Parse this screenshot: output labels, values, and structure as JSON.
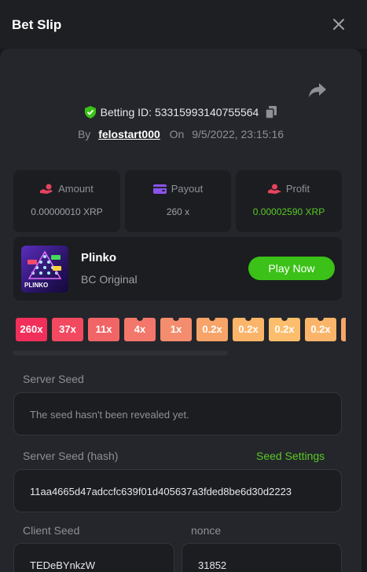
{
  "header": {
    "title": "Bet Slip",
    "close_icon": "close-icon"
  },
  "bet": {
    "betting_id_label": "Betting ID:",
    "betting_id": "53315993140755564",
    "by_label": "By",
    "username": "felostart000",
    "on_label": "On",
    "date": "9/5/2022, 23:15:16"
  },
  "stats": [
    {
      "label": "Amount",
      "value": "0.00000010 XRP",
      "icon": "coin-hand-icon",
      "color": "#e8435d"
    },
    {
      "label": "Payout",
      "value": "260 x",
      "icon": "wallet-icon",
      "color": "#8a53f0"
    },
    {
      "label": "Profit",
      "value": "0.00002590 XRP",
      "icon": "money-hand-icon",
      "color": "#e8435d"
    }
  ],
  "game": {
    "name": "Plinko",
    "subtitle": "BC Original",
    "play_label": "Play Now",
    "thumb_text": "PLINKO"
  },
  "multipliers": [
    {
      "label": "260x",
      "color": "#f0305a"
    },
    {
      "label": "37x",
      "color": "#f24960"
    },
    {
      "label": "11x",
      "color": "#f26566"
    },
    {
      "label": "4x",
      "color": "#f3776a"
    },
    {
      "label": "1x",
      "color": "#f48c6e"
    },
    {
      "label": "0.2x",
      "color": "#f8a468"
    },
    {
      "label": "0.2x",
      "color": "#fbb56a"
    },
    {
      "label": "0.2x",
      "color": "#fcbe6c"
    },
    {
      "label": "0.2x",
      "color": "#fbb56a"
    },
    {
      "label": "",
      "color": "#f8a468"
    }
  ],
  "seeds": {
    "server_seed_label": "Server Seed",
    "server_seed_value": "The seed hasn't been revealed yet.",
    "server_seed_hash_label": "Server Seed (hash)",
    "seed_settings_label": "Seed Settings",
    "server_seed_hash_value": "11aa4665d47adccfc639f01d405637a3fded8be6d30d2223",
    "client_seed_label": "Client Seed",
    "client_seed_value": "TEDeBYnkzW",
    "nonce_label": "nonce",
    "nonce_value": "31852"
  },
  "colors": {
    "accent_green": "#3bc117",
    "profit_green": "#58c925",
    "panel_bg": "#24262b"
  }
}
